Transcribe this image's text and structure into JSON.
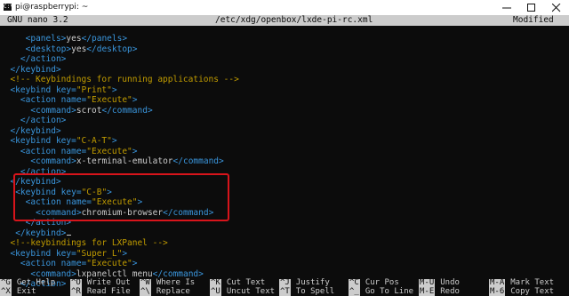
{
  "window": {
    "title": "pi@raspberrypi: ~"
  },
  "nano_header": {
    "version": "GNU nano 3.2",
    "file": "/etc/xdg/openbox/lxde-pi-rc.xml",
    "status": "Modified"
  },
  "editor_lines": [
    {
      "indent": 5,
      "segs": [
        [
          "t",
          "<panels>"
        ],
        [
          "x",
          "yes"
        ],
        [
          "t",
          "</panels>"
        ]
      ]
    },
    {
      "indent": 5,
      "segs": [
        [
          "t",
          "<desktop>"
        ],
        [
          "x",
          "yes"
        ],
        [
          "t",
          "</desktop>"
        ]
      ]
    },
    {
      "indent": 4,
      "segs": [
        [
          "t",
          "</action>"
        ]
      ]
    },
    {
      "indent": 2,
      "segs": [
        [
          "t",
          "</keybind>"
        ]
      ]
    },
    {
      "indent": 2,
      "segs": [
        [
          "c",
          "<!-- Keybindings for running applications -->"
        ]
      ]
    },
    {
      "indent": 2,
      "segs": [
        [
          "t",
          "<keybind "
        ],
        [
          "a",
          "key="
        ],
        [
          "v",
          "\"Print\""
        ],
        [
          "t",
          ">"
        ]
      ]
    },
    {
      "indent": 4,
      "segs": [
        [
          "t",
          "<action "
        ],
        [
          "a",
          "name="
        ],
        [
          "v",
          "\"Execute\""
        ],
        [
          "t",
          ">"
        ]
      ]
    },
    {
      "indent": 6,
      "segs": [
        [
          "t",
          "<command>"
        ],
        [
          "x",
          "scrot"
        ],
        [
          "t",
          "</command>"
        ]
      ]
    },
    {
      "indent": 4,
      "segs": [
        [
          "t",
          "</action>"
        ]
      ]
    },
    {
      "indent": 2,
      "segs": [
        [
          "t",
          "</keybind>"
        ]
      ]
    },
    {
      "indent": 2,
      "segs": [
        [
          "t",
          "<keybind "
        ],
        [
          "a",
          "key="
        ],
        [
          "v",
          "\"C-A-T\""
        ],
        [
          "t",
          ">"
        ]
      ]
    },
    {
      "indent": 4,
      "segs": [
        [
          "t",
          "<action "
        ],
        [
          "a",
          "name="
        ],
        [
          "v",
          "\"Execute\""
        ],
        [
          "t",
          ">"
        ]
      ]
    },
    {
      "indent": 6,
      "segs": [
        [
          "t",
          "<command>"
        ],
        [
          "x",
          "x-terminal-emulator"
        ],
        [
          "t",
          "</command>"
        ]
      ]
    },
    {
      "indent": 4,
      "segs": [
        [
          "t",
          "</action>"
        ]
      ]
    },
    {
      "indent": 2,
      "segs": [
        [
          "t",
          "</keybind>"
        ]
      ]
    },
    {
      "indent": 3,
      "segs": [
        [
          "t",
          "<keybind "
        ],
        [
          "a",
          "key="
        ],
        [
          "v",
          "\"C-B\""
        ],
        [
          "t",
          ">"
        ]
      ]
    },
    {
      "indent": 5,
      "segs": [
        [
          "t",
          "<action "
        ],
        [
          "a",
          "name="
        ],
        [
          "v",
          "\"Execute\""
        ],
        [
          "t",
          ">"
        ]
      ]
    },
    {
      "indent": 7,
      "segs": [
        [
          "t",
          "<command>"
        ],
        [
          "x",
          "chromium-browser"
        ],
        [
          "t",
          "</command>"
        ]
      ]
    },
    {
      "indent": 5,
      "segs": [
        [
          "t",
          "</action>"
        ]
      ]
    },
    {
      "indent": 3,
      "segs": [
        [
          "t",
          "</keybind>"
        ]
      ],
      "cursor": true
    },
    {
      "indent": 2,
      "segs": [
        [
          "c",
          "<!--keybindings for LXPanel -->"
        ]
      ]
    },
    {
      "indent": 2,
      "segs": [
        [
          "t",
          "<keybind "
        ],
        [
          "a",
          "key="
        ],
        [
          "v",
          "\"Super_L\""
        ],
        [
          "t",
          ">"
        ]
      ]
    },
    {
      "indent": 4,
      "segs": [
        [
          "t",
          "<action "
        ],
        [
          "a",
          "name="
        ],
        [
          "v",
          "\"Execute\""
        ],
        [
          "t",
          ">"
        ]
      ]
    },
    {
      "indent": 6,
      "segs": [
        [
          "t",
          "<command>"
        ],
        [
          "x",
          "lxpanelctl menu"
        ],
        [
          "t",
          "</command>"
        ]
      ]
    },
    {
      "indent": 4,
      "segs": [
        [
          "t",
          "</action>"
        ]
      ]
    }
  ],
  "shortcuts": [
    {
      "key": "^G",
      "label": "Get Help"
    },
    {
      "key": "^O",
      "label": "Write Out"
    },
    {
      "key": "^W",
      "label": "Where Is"
    },
    {
      "key": "^K",
      "label": "Cut Text"
    },
    {
      "key": "^J",
      "label": "Justify"
    },
    {
      "key": "^C",
      "label": "Cur Pos"
    },
    {
      "key": "M-U",
      "label": "Undo"
    },
    {
      "key": "M-A",
      "label": "Mark Text"
    },
    {
      "key": "^X",
      "label": "Exit"
    },
    {
      "key": "^R",
      "label": "Read File"
    },
    {
      "key": "^\\",
      "label": "Replace"
    },
    {
      "key": "^U",
      "label": "Uncut Text"
    },
    {
      "key": "^T",
      "label": "To Spell"
    },
    {
      "key": "^_",
      "label": "Go To Line"
    },
    {
      "key": "M-E",
      "label": "Redo"
    },
    {
      "key": "M-6",
      "label": "Copy Text"
    }
  ],
  "colors": {
    "tag": "#3a96dd",
    "string": "#c19c00",
    "highlight_box": "#d8141b"
  }
}
